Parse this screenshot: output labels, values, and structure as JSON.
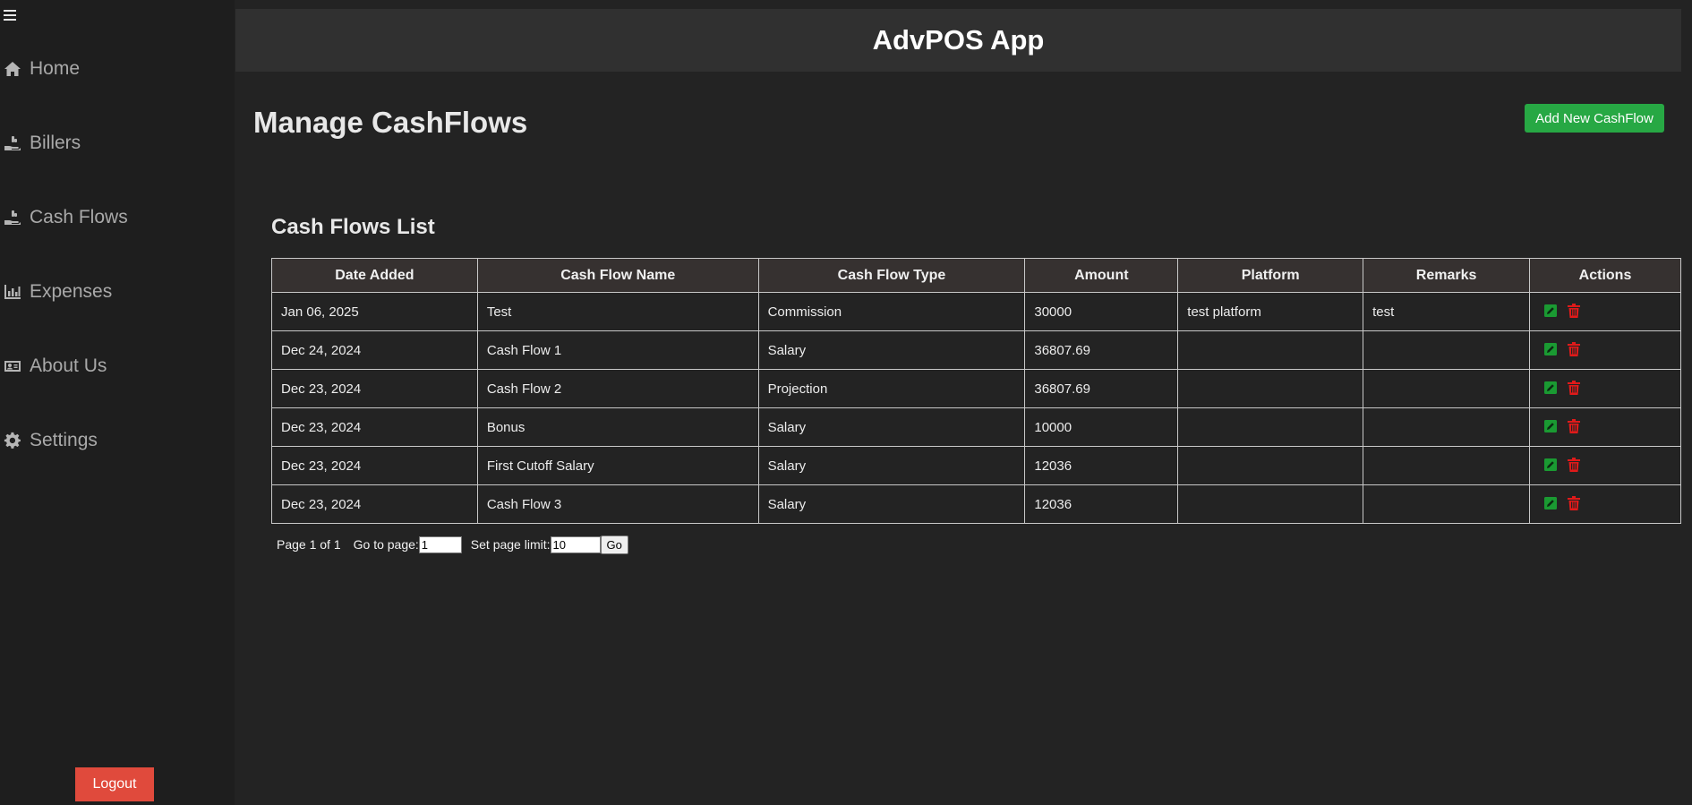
{
  "app": {
    "title": "AdvPOS App"
  },
  "sidebar": {
    "items": [
      {
        "label": "Home",
        "icon": "home-icon"
      },
      {
        "label": "Billers",
        "icon": "hand-coin-icon"
      },
      {
        "label": "Cash Flows",
        "icon": "hand-coin-icon"
      },
      {
        "label": "Expenses",
        "icon": "bar-chart-icon"
      },
      {
        "label": "About Us",
        "icon": "id-card-icon"
      },
      {
        "label": "Settings",
        "icon": "gear-icon"
      }
    ],
    "logout_label": "Logout"
  },
  "page": {
    "title": "Manage CashFlows",
    "add_button_label": "Add New CashFlow",
    "list_title": "Cash Flows List"
  },
  "table": {
    "headers": [
      "Date Added",
      "Cash Flow Name",
      "Cash Flow Type",
      "Amount",
      "Platform",
      "Remarks",
      "Actions"
    ],
    "rows": [
      {
        "date": "Jan 06, 2025",
        "name": "Test",
        "type": "Commission",
        "amount": "30000",
        "platform": "test platform",
        "remarks": "test"
      },
      {
        "date": "Dec 24, 2024",
        "name": "Cash Flow 1",
        "type": "Salary",
        "amount": "36807.69",
        "platform": "",
        "remarks": ""
      },
      {
        "date": "Dec 23, 2024",
        "name": "Cash Flow 2",
        "type": "Projection",
        "amount": "36807.69",
        "platform": "",
        "remarks": ""
      },
      {
        "date": "Dec 23, 2024",
        "name": "Bonus",
        "type": "Salary",
        "amount": "10000",
        "platform": "",
        "remarks": ""
      },
      {
        "date": "Dec 23, 2024",
        "name": "First Cutoff Salary",
        "type": "Salary",
        "amount": "12036",
        "platform": "",
        "remarks": ""
      },
      {
        "date": "Dec 23, 2024",
        "name": "Cash Flow 3",
        "type": "Salary",
        "amount": "12036",
        "platform": "",
        "remarks": ""
      }
    ]
  },
  "pagination": {
    "page_info": "Page 1 of 1",
    "goto_label": "Go to page:",
    "goto_value": "1",
    "limit_label": "Set page limit:",
    "limit_value": "10",
    "go_label": "Go"
  },
  "colors": {
    "add_button": "#27a844",
    "logout_button": "#e04a3c",
    "edit_icon": "#1a9a32",
    "delete_icon": "#e01a1a"
  }
}
